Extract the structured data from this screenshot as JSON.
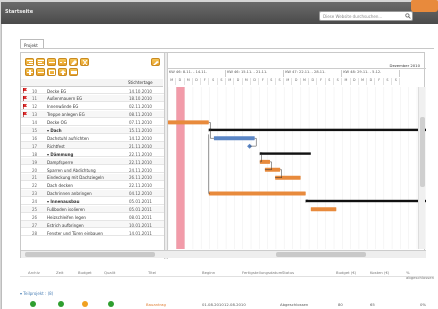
{
  "header": {
    "brand": "Startseite",
    "search_placeholder": "Diese Website durchsuchen..."
  },
  "tabs": [
    {
      "label": "Projekt"
    }
  ],
  "grid": {
    "date_col_header": "Stichtertage"
  },
  "rows": [
    {
      "id": "10",
      "name": "Decke EG",
      "date": "14.10.2010",
      "bold": false,
      "flag": "red"
    },
    {
      "id": "11",
      "name": "Außenmauern EG",
      "date": "18.10.2010",
      "bold": false,
      "flag": "red"
    },
    {
      "id": "12",
      "name": "Innenwände EG",
      "date": "02.11.2010",
      "bold": false,
      "flag": "red"
    },
    {
      "id": "13",
      "name": "Treppe anlegen EG",
      "date": "08.11.2010",
      "bold": false,
      "flag": "red"
    },
    {
      "id": "14",
      "name": "Decke OG",
      "date": "07.11.2010",
      "bold": false,
      "flag": ""
    },
    {
      "id": "15",
      "name": "▾ Dach",
      "date": "15.11.2010",
      "bold": true,
      "flag": ""
    },
    {
      "id": "16",
      "name": "Dachstuhl aufrichten",
      "date": "14.12.2010",
      "bold": false,
      "flag": ""
    },
    {
      "id": "17",
      "name": "Richtfest",
      "date": "21.11.2010",
      "bold": false,
      "flag": ""
    },
    {
      "id": "18",
      "name": "▾ Dämmung",
      "date": "22.11.2010",
      "bold": true,
      "flag": ""
    },
    {
      "id": "19",
      "name": "Dampfsperre",
      "date": "22.11.2010",
      "bold": false,
      "flag": ""
    },
    {
      "id": "20",
      "name": "Sparren und Abdichtung",
      "date": "24.11.2010",
      "bold": false,
      "flag": ""
    },
    {
      "id": "21",
      "name": "Eindeckung mit Dachziegeln",
      "date": "26.11.2010",
      "bold": false,
      "flag": ""
    },
    {
      "id": "22",
      "name": "Dach decken",
      "date": "22.11.2010",
      "bold": false,
      "flag": ""
    },
    {
      "id": "23",
      "name": "Dachrinnen anbringen",
      "date": "04.12.2010",
      "bold": false,
      "flag": ""
    },
    {
      "id": "24",
      "name": "▾ Innenausbau",
      "date": "05.01.2011",
      "bold": true,
      "flag": ""
    },
    {
      "id": "25",
      "name": "Fußboden isolieren",
      "date": "05.01.2011",
      "bold": false,
      "flag": ""
    },
    {
      "id": "26",
      "name": "Heizschleifen legen",
      "date": "08.01.2011",
      "bold": false,
      "flag": ""
    },
    {
      "id": "27",
      "name": "Estrich aufbringen",
      "date": "10.01.2011",
      "bold": false,
      "flag": ""
    },
    {
      "id": "28",
      "name": "Fenster und Türen einbauen",
      "date": "14.01.2011",
      "bold": false,
      "flag": ""
    }
  ],
  "timeline": {
    "month_label": "Dezember 2010",
    "weeks": [
      "KW 46: 8.11. - 14.11.",
      "KW 46: 15.11. - 21.11.",
      "KW 47: 22.11. - 28.11.",
      "KW 48: 29.11. - 5.12."
    ],
    "day_letters": [
      "M",
      "D",
      "M",
      "D",
      "F",
      "S",
      "S",
      "M",
      "D",
      "M",
      "D",
      "F",
      "S",
      "S",
      "M",
      "D",
      "M",
      "D",
      "F",
      "S",
      "S",
      "M",
      "D",
      "M",
      "D",
      "F",
      "S",
      "S"
    ],
    "day_numbers": [
      "8",
      "9",
      "10",
      "11",
      "12",
      "13",
      "14",
      "15",
      "16",
      "17",
      "18",
      "19",
      "20",
      "21",
      "22",
      "23",
      "24",
      "25",
      "26",
      "27",
      "28",
      "29",
      "30",
      "1",
      "2",
      "3",
      "4",
      "5"
    ]
  },
  "bottom": {
    "headers": [
      "Archiv",
      "Zeit",
      "Budget",
      "Qualit",
      "Titel",
      "Beginn",
      "Fertigstellungsdatum",
      "Status",
      "Budget (€)",
      "Kosten (€)",
      "% abgeschlossen"
    ],
    "group_label": "▾ Teilprojekt : (8)",
    "row": {
      "title": "Bauantrag",
      "begin": "01.08.2010",
      "end": "12.08.2010",
      "status": "Abgeschlossen",
      "budget": "80",
      "cost": "65",
      "percent": "0%"
    }
  },
  "colors": {
    "bar_orange": "#e88a3c",
    "bar_blue": "#5b86c5",
    "summary_black": "#111111",
    "today_marker": "#f08a9a",
    "status_green": "#2f9e2f",
    "status_orange": "#f0a020"
  },
  "tasks": [
    {
      "row": 4,
      "kind": "bar",
      "color": "orange",
      "start": 0,
      "end": 8
    },
    {
      "row": 5,
      "kind": "summary",
      "start": 8,
      "end": 60
    },
    {
      "row": 6,
      "kind": "bar",
      "color": "blue",
      "start": 9,
      "end": 17
    },
    {
      "row": 7,
      "kind": "milestone",
      "start": 16,
      "end": 16
    },
    {
      "row": 8,
      "kind": "summary",
      "start": 18,
      "end": 28
    },
    {
      "row": 9,
      "kind": "bar",
      "color": "orange",
      "start": 18,
      "end": 20
    },
    {
      "row": 10,
      "kind": "bar",
      "color": "orange",
      "start": 19,
      "end": 22
    },
    {
      "row": 11,
      "kind": "bar",
      "color": "orange",
      "start": 21,
      "end": 26
    },
    {
      "row": 13,
      "kind": "bar",
      "color": "orange",
      "start": 8,
      "end": 27
    },
    {
      "row": 14,
      "kind": "summary",
      "start": 27,
      "end": 60
    },
    {
      "row": 15,
      "kind": "bar",
      "color": "orange",
      "start": 28,
      "end": 33
    }
  ],
  "today_day_index": 1
}
